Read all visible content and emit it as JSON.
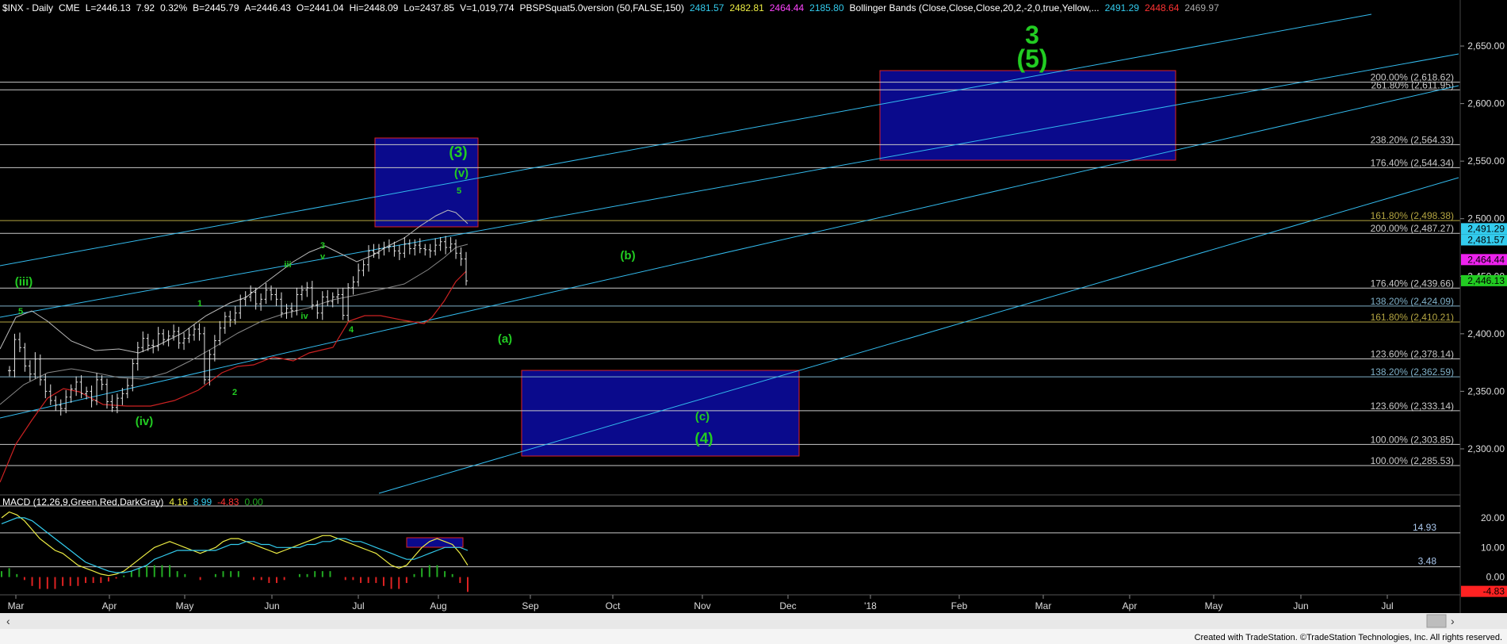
{
  "header": [
    {
      "text": "$INX - Daily",
      "color": "#ffffff"
    },
    {
      "text": "CME",
      "color": "#ffffff"
    },
    {
      "text": "L=2446.13",
      "color": "#ffffff"
    },
    {
      "text": "7.92",
      "color": "#ffffff"
    },
    {
      "text": "0.32%",
      "color": "#ffffff"
    },
    {
      "text": "B=2445.79",
      "color": "#ffffff"
    },
    {
      "text": "A=2446.43",
      "color": "#ffffff"
    },
    {
      "text": "O=2441.04",
      "color": "#ffffff"
    },
    {
      "text": "Hi=2448.09",
      "color": "#ffffff"
    },
    {
      "text": "Lo=2437.85",
      "color": "#ffffff"
    },
    {
      "text": "V=1,019,774",
      "color": "#ffffff"
    },
    {
      "text": "PBSPSquat5.0version (50,FALSE,150)",
      "color": "#ffffff"
    },
    {
      "text": "2481.57",
      "color": "#33ccee"
    },
    {
      "text": "2482.81",
      "color": "#eeee44"
    },
    {
      "text": "2464.44",
      "color": "#ff44ff"
    },
    {
      "text": "2185.80",
      "color": "#33ccee"
    },
    {
      "text": "Bollinger Bands (Close,Close,Close,20,2,-2,0,true,Yellow,...",
      "color": "#ffffff"
    },
    {
      "text": "2491.29",
      "color": "#33ccee"
    },
    {
      "text": "2448.64",
      "color": "#ff3333"
    },
    {
      "text": "2469.97",
      "color": "#aaaaaa"
    }
  ],
  "macd_header": [
    {
      "text": "MACD (12,26,9,Green,Red,DarkGray)",
      "color": "#ffffff"
    },
    {
      "text": "4.16",
      "color": "#eeee44"
    },
    {
      "text": "8.99",
      "color": "#33ccee"
    },
    {
      "text": "-4.83",
      "color": "#ff3333"
    },
    {
      "text": "0.00",
      "color": "#22aa22"
    }
  ],
  "footer": "Created with TradeStation. ©TradeStation Technologies, Inc. All rights reserved.",
  "colors": {
    "background": "#000000",
    "cyan": "#33bbee",
    "box_fill": "#0a0a8c",
    "box_border": "#dd2222",
    "label_green": "#22cc22",
    "level_line": "#c8c8c8"
  },
  "chart_data": [
    {
      "type": "candlestick",
      "title": "$INX - Daily",
      "ylim": [
        2260,
        2690
      ],
      "y_ticks": [
        2300,
        2350,
        2400,
        2450,
        2500,
        2550,
        2600,
        2650
      ],
      "y_tick_labels": [
        "2,300.00",
        "2,350.00",
        "2,400.00",
        "2,450.00",
        "2,500.00",
        "2,550.00",
        "2,600.00",
        "2,650.00"
      ],
      "x_tick_labels": [
        "Mar",
        "Apr",
        "May",
        "Jun",
        "Jul",
        "Aug",
        "Sep",
        "Oct",
        "Nov",
        "Dec",
        "'18",
        "Feb",
        "Mar",
        "Apr",
        "May",
        "Jun",
        "Jul"
      ],
      "close_series": [
        2368,
        2395,
        2388,
        2372,
        2365,
        2378,
        2360,
        2350,
        2342,
        2338,
        2335,
        2345,
        2352,
        2358,
        2348,
        2350,
        2342,
        2360,
        2356,
        2341,
        2336,
        2344,
        2348,
        2355,
        2374,
        2388,
        2396,
        2390,
        2389,
        2400,
        2395,
        2398,
        2402,
        2392,
        2396,
        2399,
        2404,
        2400,
        2360,
        2382,
        2394,
        2405,
        2415,
        2412,
        2418,
        2430,
        2432,
        2436,
        2426,
        2430,
        2438,
        2434,
        2430,
        2418,
        2422,
        2420,
        2434,
        2438,
        2440,
        2425,
        2418,
        2432,
        2428,
        2432,
        2434,
        2416,
        2440,
        2445,
        2455,
        2460,
        2472,
        2470,
        2474,
        2475,
        2476,
        2472,
        2470,
        2478,
        2474,
        2477,
        2474,
        2473,
        2472,
        2477,
        2480,
        2475,
        2478,
        2470,
        2465,
        2446
      ],
      "price_labels_right": [
        {
          "y": 2491.29,
          "text": "2,491.29",
          "bg": "#33ccee",
          "fg": "#000000"
        },
        {
          "y": 2481.57,
          "text": "2,481.57",
          "bg": "#33ccee",
          "fg": "#000000"
        },
        {
          "y": 2464.44,
          "text": "2,464.44",
          "bg": "#ee22ee",
          "fg": "#000000"
        },
        {
          "y": 2446.13,
          "text": "2,446.13",
          "bg": "#22cc22",
          "fg": "#000000"
        }
      ],
      "fib_levels": [
        {
          "y": 2618.62,
          "label": "200.00% (2,618.62)",
          "color": "#c8c8c8"
        },
        {
          "y": 2611.95,
          "label": "261.80% (2,611.95)",
          "color": "#c8c8c8"
        },
        {
          "y": 2564.33,
          "label": "238.20% (2,564.33)",
          "color": "#c8c8c8"
        },
        {
          "y": 2544.34,
          "label": "176.40% (2,544.34)",
          "color": "#c8c8c8"
        },
        {
          "y": 2498.38,
          "label": "161.80% (2,498.38)",
          "color": "#b5a642"
        },
        {
          "y": 2487.27,
          "label": "200.00% (2,487.27)",
          "color": "#c8c8c8"
        },
        {
          "y": 2439.66,
          "label": "176.40% (2,439.66)",
          "color": "#c8c8c8"
        },
        {
          "y": 2424.09,
          "label": "138.20% (2,424.09)",
          "color": "#7fb0c8"
        },
        {
          "y": 2410.21,
          "label": "161.80% (2,410.21)",
          "color": "#b5a642"
        },
        {
          "y": 2378.14,
          "label": "123.60% (2,378.14)",
          "color": "#c8c8c8"
        },
        {
          "y": 2362.59,
          "label": "138.20% (2,362.59)",
          "color": "#7fb0c8"
        },
        {
          "y": 2333.14,
          "label": "123.60% (2,333.14)",
          "color": "#c8c8c8"
        },
        {
          "y": 2303.85,
          "label": "100.00% (2,303.85)",
          "color": "#c8c8c8"
        },
        {
          "y": 2285.53,
          "label": "100.00% (2,285.53)",
          "color": "#c8c8c8"
        }
      ],
      "wave_labels": [
        {
          "text": "3",
          "size": "big"
        },
        {
          "text": "(5)",
          "size": "big"
        },
        {
          "text": "(3)",
          "size": "mid"
        },
        {
          "text": "(v)",
          "size": "small"
        },
        {
          "text": "5",
          "size": "tiny"
        },
        {
          "text": "(b)",
          "size": "small"
        },
        {
          "text": "(a)",
          "size": "small"
        },
        {
          "text": "(c)",
          "size": "small"
        },
        {
          "text": "(4)",
          "size": "mid"
        },
        {
          "text": "(iii)",
          "size": "small"
        },
        {
          "text": "5",
          "size": "tiny"
        },
        {
          "text": "(iv)",
          "size": "small"
        },
        {
          "text": "1",
          "size": "tiny"
        },
        {
          "text": "2",
          "size": "tiny"
        },
        {
          "text": "iii",
          "size": "tiny"
        },
        {
          "text": "3",
          "size": "tiny"
        },
        {
          "text": "v",
          "size": "tiny"
        },
        {
          "text": "iv",
          "size": "tiny"
        },
        {
          "text": "4",
          "size": "tiny"
        }
      ]
    },
    {
      "type": "line",
      "title": "MACD (12,26,9,Green,Red,DarkGray)",
      "ylim": [
        -6,
        24
      ],
      "y_ticks": [
        0,
        10,
        20
      ],
      "y_tick_labels": [
        "0.00",
        "10.00",
        "20.00"
      ],
      "levels": [
        {
          "y": 14.93,
          "label": "14.93"
        },
        {
          "y": 3.48,
          "label": "3.48"
        }
      ],
      "last_value_label": {
        "text": "-4.83",
        "bg": "#ff2222"
      },
      "macd": [
        20,
        22,
        21,
        19,
        16,
        13,
        11,
        9,
        8,
        6,
        4,
        3,
        2,
        1,
        0.5,
        1,
        2,
        4,
        6,
        8,
        10,
        11,
        12,
        11,
        10,
        9,
        8,
        9,
        10,
        12,
        13,
        13,
        12,
        11,
        10,
        9,
        8,
        9,
        10,
        11,
        12,
        13,
        14,
        14,
        13,
        12,
        11,
        10,
        9,
        8,
        6,
        4,
        3,
        4,
        7,
        10,
        12,
        13,
        12,
        11,
        8,
        4
      ],
      "signal": [
        18,
        19,
        20,
        20,
        19,
        17,
        15,
        13,
        11,
        9,
        7,
        5,
        4,
        3,
        2,
        1.5,
        1.5,
        2,
        3,
        4,
        6,
        7,
        8,
        9,
        9,
        9,
        9,
        9,
        9,
        10,
        11,
        11,
        12,
        12,
        11,
        11,
        10,
        10,
        10,
        10,
        11,
        11,
        12,
        12,
        13,
        13,
        12,
        12,
        11,
        10,
        9,
        8,
        7,
        6,
        6,
        7,
        8,
        9,
        10,
        10,
        10,
        9
      ]
    }
  ]
}
